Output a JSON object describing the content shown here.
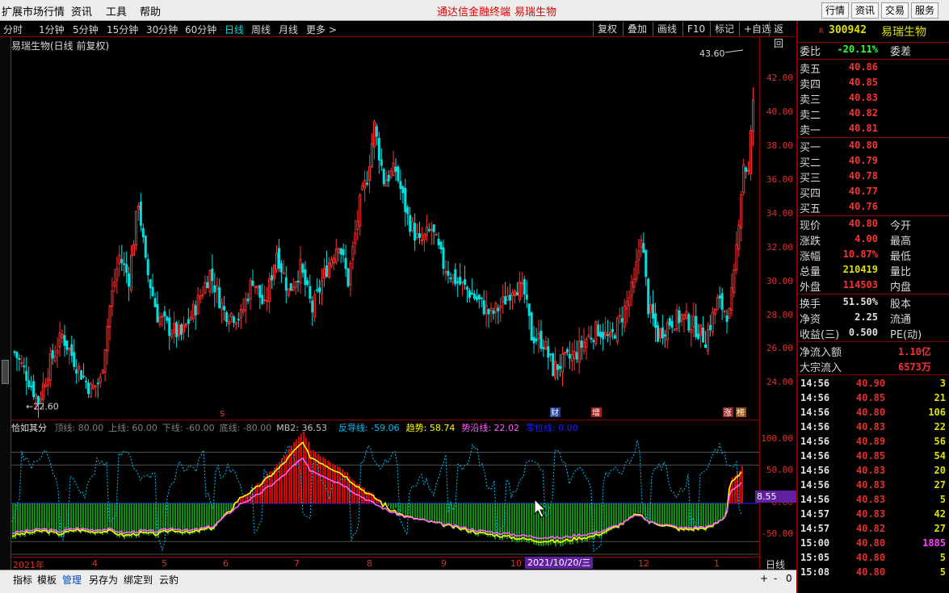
{
  "menu": {
    "items": [
      "扩展市场行情",
      "资讯",
      "工具",
      "帮助"
    ],
    "app_title": "通达信金融终端",
    "stock_title": "易瑞生物",
    "right_buttons": [
      "行情",
      "资讯",
      "交易",
      "服务"
    ]
  },
  "toolbar": {
    "periods": [
      "分时",
      "1分钟",
      "5分钟",
      "15分钟",
      "30分钟",
      "60分钟",
      "日线",
      "周线",
      "月线",
      "更多 >"
    ],
    "active_period": "日线",
    "buttons": [
      "复权",
      "叠加",
      "画线",
      "F10",
      "标记",
      "+自选",
      "返回"
    ]
  },
  "chart": {
    "title": "易瑞生物(日线 前复权)",
    "max_label": "43.60",
    "min_label": "22.60",
    "y_ticks": [
      "42.00",
      "40.00",
      "38.00",
      "36.00",
      "34.00",
      "32.00",
      "30.00",
      "28.00",
      "26.00",
      "24.00"
    ],
    "markers": {
      "s": "S",
      "cai": "财",
      "zeng": "增",
      "zhang": "涨",
      "bang": "榜"
    },
    "colors": {
      "up": "#ff3030",
      "down": "#00e0e0"
    }
  },
  "indicator": {
    "name": "恰如其分",
    "params": [
      {
        "text": "顶线: 80.00",
        "color": "#808080"
      },
      {
        "text": "上线: 60.00",
        "color": "#808080"
      },
      {
        "text": "下线: -60.00",
        "color": "#808080"
      },
      {
        "text": "底线: -80.00",
        "color": "#808080"
      },
      {
        "text": "MB2: 36.53",
        "color": "#c0c0c0"
      }
    ],
    "lines": [
      {
        "text": "反导线: -59.06",
        "color": "#00c0ff"
      },
      {
        "text": "趋势: 58.74",
        "color": "#ffff00"
      },
      {
        "text": "势沿线: 22.02",
        "color": "#ff60ff"
      },
      {
        "text": "零位线: 0.00",
        "color": "#2020ff"
      }
    ],
    "y_ticks": [
      "100.00",
      "50.00",
      "0.00",
      "-50.00"
    ],
    "current_value": "8.55"
  },
  "xaxis": {
    "labels": [
      "2021年",
      "4",
      "5",
      "6",
      "7",
      "8",
      "9",
      "10",
      "12",
      "1"
    ],
    "cursor_date": "2021/10/20/三",
    "period_label": "日线"
  },
  "bottom": {
    "tabs": [
      "指标",
      "模板",
      "管理",
      "另存为",
      "绑定到",
      "云豹"
    ],
    "active": "管理",
    "zoom": [
      "+",
      "-",
      "0"
    ]
  },
  "quote": {
    "code": "300942",
    "name": "易瑞生物",
    "weibi_label": "委比",
    "weibi": "-20.11%",
    "weicha_label": "委差",
    "sell": [
      {
        "label": "卖五",
        "price": "40.86"
      },
      {
        "label": "卖四",
        "price": "40.85"
      },
      {
        "label": "卖三",
        "price": "40.83"
      },
      {
        "label": "卖二",
        "price": "40.82"
      },
      {
        "label": "卖一",
        "price": "40.81"
      }
    ],
    "buy": [
      {
        "label": "买一",
        "price": "40.80"
      },
      {
        "label": "买二",
        "price": "40.79"
      },
      {
        "label": "买三",
        "price": "40.78"
      },
      {
        "label": "买四",
        "price": "40.77"
      },
      {
        "label": "买五",
        "price": "40.76"
      }
    ],
    "stats": [
      {
        "label": "现价",
        "value": "40.80",
        "label2": "今开",
        "color": "#ff3030"
      },
      {
        "label": "涨跌",
        "value": "4.00",
        "label2": "最高",
        "color": "#ff3030"
      },
      {
        "label": "涨幅",
        "value": "10.87%",
        "label2": "最低",
        "color": "#ff3030"
      },
      {
        "label": "总量",
        "value": "210419",
        "label2": "量比",
        "color": "#e0e000"
      },
      {
        "label": "外盘",
        "value": "114503",
        "label2": "内盘",
        "color": "#ff3030"
      }
    ],
    "stats2": [
      {
        "label": "换手",
        "value": "51.50%",
        "label2": "股本",
        "color": "#e0e0e0"
      },
      {
        "label": "净资",
        "value": "2.25",
        "label2": "流通",
        "color": "#e0e0e0"
      },
      {
        "label": "收益(三)",
        "value": "0.500",
        "label2": "PE(动)",
        "color": "#e0e0e0"
      }
    ],
    "flows": [
      {
        "label": "净流入额",
        "value": "1.10亿"
      },
      {
        "label": "大宗流入",
        "value": "6573万"
      }
    ],
    "ticks": [
      {
        "time": "14:56",
        "price": "40.90",
        "vol": "3",
        "color": "#e0e000"
      },
      {
        "time": "14:56",
        "price": "40.85",
        "vol": "21",
        "color": "#e0e000"
      },
      {
        "time": "14:56",
        "price": "40.80",
        "vol": "106",
        "color": "#e0e000"
      },
      {
        "time": "14:56",
        "price": "40.83",
        "vol": "22",
        "color": "#e0e000"
      },
      {
        "time": "14:56",
        "price": "40.89",
        "vol": "56",
        "color": "#e0e000"
      },
      {
        "time": "14:56",
        "price": "40.85",
        "vol": "54",
        "color": "#e0e000"
      },
      {
        "time": "14:56",
        "price": "40.83",
        "vol": "20",
        "color": "#e0e000"
      },
      {
        "time": "14:56",
        "price": "40.83",
        "vol": "27",
        "color": "#e0e000"
      },
      {
        "time": "14:56",
        "price": "40.83",
        "vol": "5",
        "color": "#e0e000"
      },
      {
        "time": "14:57",
        "price": "40.83",
        "vol": "42",
        "color": "#e0e000"
      },
      {
        "time": "14:57",
        "price": "40.82",
        "vol": "27",
        "color": "#e0e000"
      },
      {
        "time": "15:00",
        "price": "40.80",
        "vol": "1885",
        "color": "#ff40ff"
      },
      {
        "time": "15:05",
        "price": "40.80",
        "vol": "5",
        "color": "#e0e000"
      },
      {
        "time": "15:08",
        "price": "40.80",
        "vol": "5",
        "color": "#e0e000"
      }
    ]
  }
}
